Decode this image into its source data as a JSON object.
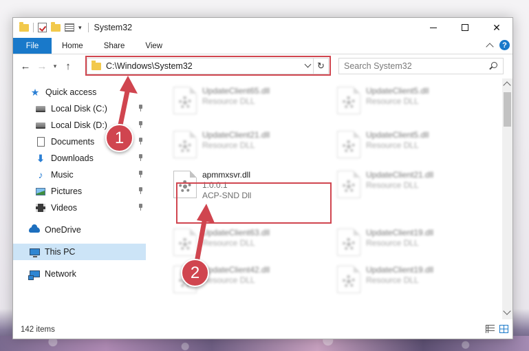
{
  "window": {
    "title": "System32"
  },
  "ribbon": {
    "tabs": [
      "File",
      "Home",
      "Share",
      "View"
    ],
    "help": "?"
  },
  "address": {
    "path": "C:\\Windows\\System32",
    "refresh": "↻"
  },
  "search": {
    "placeholder": "Search System32"
  },
  "nav": {
    "back": "←",
    "forward": "→",
    "recent": "▾",
    "up": "↑"
  },
  "sidebar": {
    "items": [
      {
        "label": "Quick access",
        "icon": "star-icon"
      },
      {
        "label": "Local Disk (C:)",
        "icon": "disk-icon",
        "pinned": true
      },
      {
        "label": "Local Disk (D:)",
        "icon": "disk-icon",
        "pinned": true
      },
      {
        "label": "Documents",
        "icon": "document-icon",
        "pinned": true
      },
      {
        "label": "Downloads",
        "icon": "download-icon",
        "pinned": true
      },
      {
        "label": "Music",
        "icon": "music-icon",
        "pinned": true
      },
      {
        "label": "Pictures",
        "icon": "pictures-icon",
        "pinned": true
      },
      {
        "label": "Videos",
        "icon": "videos-icon",
        "pinned": true
      },
      {
        "label": "OneDrive",
        "icon": "onedrive-icon"
      },
      {
        "label": "This PC",
        "icon": "this-pc-icon",
        "selected": true
      },
      {
        "label": "Network",
        "icon": "network-icon"
      }
    ]
  },
  "files": {
    "left": [
      {
        "name": "UpdateClient65.dll",
        "type": "Resource DLL"
      },
      {
        "name": "UpdateClient21.dll",
        "type": "Resource DLL"
      },
      {
        "name": "apmmxsvr.dll",
        "version": "1.0.0.1",
        "type": "ACP-SND Dll"
      },
      {
        "name": "UpdateClient63.dll",
        "type": "Resource DLL"
      },
      {
        "name": "UpdateClient42.dll",
        "type": "Resource DLL"
      }
    ],
    "right": [
      {
        "name": "UpdateClient5.dll",
        "type": "Resource DLL"
      },
      {
        "name": "UpdateClient5.dll",
        "type": "Resource DLL"
      },
      {
        "name": "UpdateClient21.dll",
        "type": "Resource DLL"
      },
      {
        "name": "UpdateClient19.dll",
        "type": "Resource DLL"
      },
      {
        "name": "UpdateClient19.dll",
        "type": "Resource DLL"
      }
    ]
  },
  "status": {
    "item_count": "142 items"
  },
  "annotations": {
    "step1": "1",
    "step2": "2",
    "color": "#d0454f"
  }
}
